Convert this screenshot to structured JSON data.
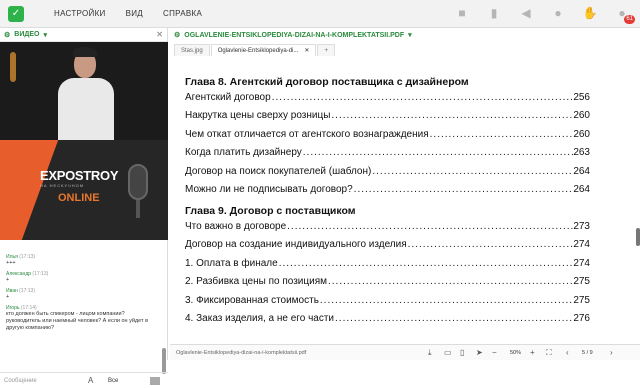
{
  "menu": {
    "items": [
      "НАСТРОЙКИ",
      "ВИД",
      "СПРАВКА"
    ]
  },
  "top_icons": [
    {
      "name": "camera-icon",
      "glyph": "■"
    },
    {
      "name": "mic-icon",
      "glyph": "▮"
    },
    {
      "name": "speaker-icon",
      "glyph": "◀"
    },
    {
      "name": "users-icon",
      "glyph": "●"
    },
    {
      "name": "raise-hand-icon",
      "glyph": "✋"
    },
    {
      "name": "notifications-icon",
      "glyph": "●",
      "badge": "61"
    }
  ],
  "video_panel": {
    "title": "ВИДЕО"
  },
  "brand": {
    "name": "EXPOSTROY",
    "sub": "НА НЕСКУЧНОМ",
    "online": "ONLINE"
  },
  "chat": {
    "messages": [
      {
        "name": "Илья",
        "time": "(17:13)",
        "text": "+++"
      },
      {
        "name": "Александр",
        "time": "(17:13)",
        "text": "+"
      },
      {
        "name": "Иван",
        "time": "(17:13)",
        "text": "+"
      },
      {
        "name": "Игорь",
        "time": "(17:14)",
        "text": "кто должен быть спикером - лицом компании? руководитель или наемный человек? А если он уйдет в другую компанию?"
      }
    ],
    "input_placeholder": "Сообщение",
    "recipient": "Все"
  },
  "doc": {
    "panel_title": "OGLAVLENIE-ENTSIKLOPEDIYA-DIZAI-NA-I-KOMPLEKTATSII.PDF",
    "tabs": [
      "Stas.jpg",
      "Oglavlenie-Entsiklopediya-di..."
    ],
    "footer_filename": "Oglavlenie-Entsiklopediya-dizai-na-i-komplektatsii.pdf",
    "zoom": "50%",
    "page_current": "5",
    "page_total": "9",
    "chapters": [
      {
        "title": "Глава 8. Агентский договор поставщика с дизайнером",
        "rows": [
          {
            "text": "Агентский договор",
            "page": "256"
          },
          {
            "text": "Накрутка цены сверху розницы",
            "page": "260"
          },
          {
            "text": "Чем откат отличается от агентского вознаграждения",
            "page": "260"
          },
          {
            "text": "Когда платить дизайнеру",
            "page": "263"
          },
          {
            "text": "Договор на поиск покупателей (шаблон)",
            "page": "264"
          },
          {
            "text": "Можно ли не подписывать договор?",
            "page": "264"
          }
        ]
      },
      {
        "title": "Глава 9. Договор с поставщиком",
        "rows": [
          {
            "text": "Что важно в договоре",
            "page": "273"
          },
          {
            "text": "Договор на создание индивидуального изделия",
            "page": "274"
          },
          {
            "text": "1. Оплата в финале",
            "page": "274"
          },
          {
            "text": "2. Разбивка цены по позициям",
            "page": "275"
          },
          {
            "text": "3. Фиксированная стоимость",
            "page": "275"
          },
          {
            "text": "4. Заказ изделия, а не его части",
            "page": "276"
          }
        ]
      }
    ]
  }
}
